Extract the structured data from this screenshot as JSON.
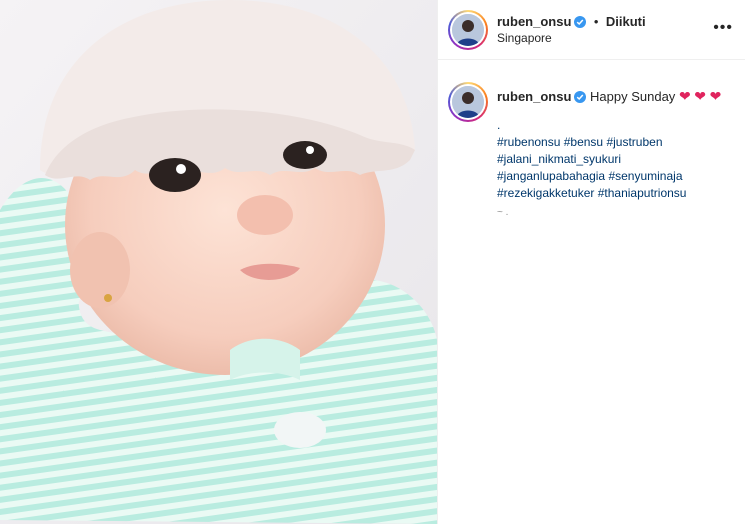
{
  "post": {
    "header": {
      "username": "ruben_onsu",
      "separator": "•",
      "follow_label": "Diikuti",
      "location": "Singapore",
      "more_icon": "more-horizontal-icon"
    },
    "caption": {
      "username": "ruben_onsu",
      "text": "Happy Sunday",
      "emoji": "❤",
      "dot": ".",
      "hashtags_lines": [
        [
          "#rubenonsu",
          "#bensu",
          "#justruben"
        ],
        [
          "#jalani_nikmati_syukuri"
        ],
        [
          "#janganlupabahagia",
          "#senyuminaja"
        ],
        [
          "#rezekigakketuker",
          "#thaniaputrionsu"
        ]
      ],
      "tail": "~ ."
    }
  }
}
